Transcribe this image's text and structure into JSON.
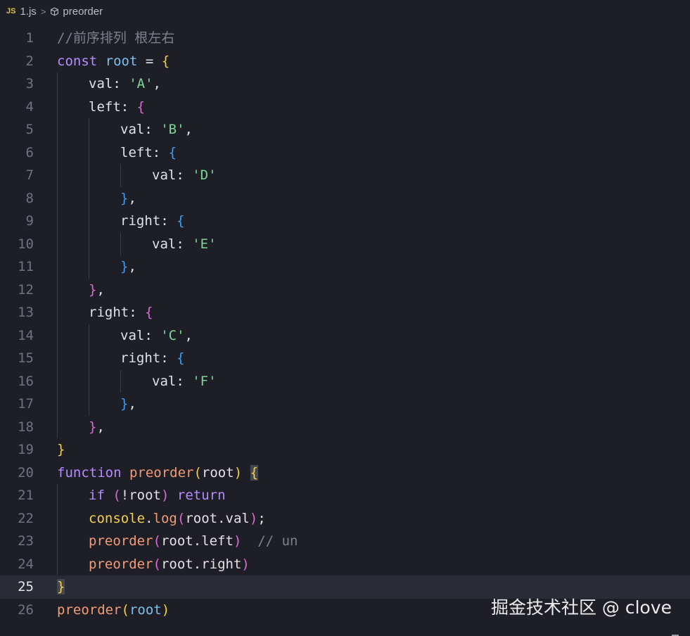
{
  "breadcrumb": {
    "file_icon": "JS",
    "file_name": "1.js",
    "separator": ">",
    "symbol_name": "preorder"
  },
  "editor": {
    "active_line": 25,
    "lines": [
      {
        "n": "1",
        "indent": 0,
        "tokens": [
          {
            "t": "//前序排列 根左右",
            "c": "c"
          }
        ]
      },
      {
        "n": "2",
        "indent": 0,
        "tokens": [
          {
            "t": "const ",
            "c": "k"
          },
          {
            "t": "root",
            "c": "v"
          },
          {
            "t": " = ",
            "c": "p"
          },
          {
            "t": "{",
            "c": "b1"
          }
        ]
      },
      {
        "n": "3",
        "indent": 1,
        "tokens": [
          {
            "t": "val: ",
            "c": "p"
          },
          {
            "t": "'A'",
            "c": "s"
          },
          {
            "t": ",",
            "c": "p"
          }
        ]
      },
      {
        "n": "4",
        "indent": 1,
        "tokens": [
          {
            "t": "left: ",
            "c": "p"
          },
          {
            "t": "{",
            "c": "b2"
          }
        ]
      },
      {
        "n": "5",
        "indent": 2,
        "tokens": [
          {
            "t": "val: ",
            "c": "p"
          },
          {
            "t": "'B'",
            "c": "s"
          },
          {
            "t": ",",
            "c": "p"
          }
        ]
      },
      {
        "n": "6",
        "indent": 2,
        "tokens": [
          {
            "t": "left: ",
            "c": "p"
          },
          {
            "t": "{",
            "c": "b3"
          }
        ]
      },
      {
        "n": "7",
        "indent": 3,
        "tokens": [
          {
            "t": "val: ",
            "c": "p"
          },
          {
            "t": "'D'",
            "c": "s"
          }
        ]
      },
      {
        "n": "8",
        "indent": 2,
        "tokens": [
          {
            "t": "}",
            "c": "b3"
          },
          {
            "t": ",",
            "c": "p"
          }
        ]
      },
      {
        "n": "9",
        "indent": 2,
        "tokens": [
          {
            "t": "right: ",
            "c": "p"
          },
          {
            "t": "{",
            "c": "b3"
          }
        ]
      },
      {
        "n": "10",
        "indent": 3,
        "tokens": [
          {
            "t": "val: ",
            "c": "p"
          },
          {
            "t": "'E'",
            "c": "s"
          }
        ]
      },
      {
        "n": "11",
        "indent": 2,
        "tokens": [
          {
            "t": "}",
            "c": "b3"
          },
          {
            "t": ",",
            "c": "p"
          }
        ]
      },
      {
        "n": "12",
        "indent": 1,
        "tokens": [
          {
            "t": "}",
            "c": "b2"
          },
          {
            "t": ",",
            "c": "p"
          }
        ]
      },
      {
        "n": "13",
        "indent": 1,
        "tokens": [
          {
            "t": "right: ",
            "c": "p"
          },
          {
            "t": "{",
            "c": "b2"
          }
        ]
      },
      {
        "n": "14",
        "indent": 2,
        "tokens": [
          {
            "t": "val: ",
            "c": "p"
          },
          {
            "t": "'C'",
            "c": "s"
          },
          {
            "t": ",",
            "c": "p"
          }
        ]
      },
      {
        "n": "15",
        "indent": 2,
        "tokens": [
          {
            "t": "right: ",
            "c": "p"
          },
          {
            "t": "{",
            "c": "b3"
          }
        ]
      },
      {
        "n": "16",
        "indent": 3,
        "tokens": [
          {
            "t": "val: ",
            "c": "p"
          },
          {
            "t": "'F'",
            "c": "s"
          }
        ]
      },
      {
        "n": "17",
        "indent": 2,
        "tokens": [
          {
            "t": "}",
            "c": "b3"
          },
          {
            "t": ",",
            "c": "p"
          }
        ]
      },
      {
        "n": "18",
        "indent": 1,
        "tokens": [
          {
            "t": "}",
            "c": "b2"
          },
          {
            "t": ",",
            "c": "p"
          }
        ]
      },
      {
        "n": "19",
        "indent": 0,
        "tokens": [
          {
            "t": "}",
            "c": "b1"
          }
        ]
      },
      {
        "n": "20",
        "indent": 0,
        "tokens": [
          {
            "t": "function ",
            "c": "k"
          },
          {
            "t": "preorder",
            "c": "f"
          },
          {
            "t": "(",
            "c": "b1"
          },
          {
            "t": "root",
            "c": "ob"
          },
          {
            "t": ")",
            "c": "b1"
          },
          {
            "t": " ",
            "c": "p"
          },
          {
            "t": "{",
            "c": "b1",
            "hl": true
          }
        ]
      },
      {
        "n": "21",
        "indent": 1,
        "tokens": [
          {
            "t": "if ",
            "c": "k"
          },
          {
            "t": "(",
            "c": "b2"
          },
          {
            "t": "!root",
            "c": "ob"
          },
          {
            "t": ")",
            "c": "b2"
          },
          {
            "t": " return",
            "c": "k"
          }
        ]
      },
      {
        "n": "22",
        "indent": 1,
        "tokens": [
          {
            "t": "console",
            "c": "b1"
          },
          {
            "t": ".",
            "c": "p"
          },
          {
            "t": "log",
            "c": "f"
          },
          {
            "t": "(",
            "c": "b2"
          },
          {
            "t": "root",
            "c": "ob"
          },
          {
            "t": ".",
            "c": "p"
          },
          {
            "t": "val",
            "c": "ob"
          },
          {
            "t": ")",
            "c": "b2"
          },
          {
            "t": ";",
            "c": "p"
          }
        ]
      },
      {
        "n": "23",
        "indent": 1,
        "tokens": [
          {
            "t": "preorder",
            "c": "f"
          },
          {
            "t": "(",
            "c": "b2"
          },
          {
            "t": "root",
            "c": "ob"
          },
          {
            "t": ".",
            "c": "p"
          },
          {
            "t": "left",
            "c": "ob"
          },
          {
            "t": ")",
            "c": "b2"
          },
          {
            "t": "  ",
            "c": "p"
          },
          {
            "t": "// un",
            "c": "c"
          }
        ]
      },
      {
        "n": "24",
        "indent": 1,
        "tokens": [
          {
            "t": "preorder",
            "c": "f"
          },
          {
            "t": "(",
            "c": "b2"
          },
          {
            "t": "root",
            "c": "ob"
          },
          {
            "t": ".",
            "c": "p"
          },
          {
            "t": "right",
            "c": "ob"
          },
          {
            "t": ")",
            "c": "b2"
          }
        ]
      },
      {
        "n": "25",
        "indent": 0,
        "tokens": [
          {
            "t": "}",
            "c": "b1",
            "hl": true
          }
        ]
      },
      {
        "n": "26",
        "indent": 0,
        "tokens": [
          {
            "t": "preorder",
            "c": "f"
          },
          {
            "t": "(",
            "c": "b1"
          },
          {
            "t": "root",
            "c": "v"
          },
          {
            "t": ")",
            "c": "b1"
          }
        ]
      }
    ]
  },
  "watermark": "掘金技术社区 @ clove",
  "colors": {
    "background": "#1e1f26",
    "keyword": "#b48cff",
    "variable": "#7cc0f0",
    "string": "#7ed69a",
    "function": "#f29b78",
    "comment": "#7d818c",
    "bracket_level1": "#f3d049",
    "bracket_level2": "#db6bd2",
    "bracket_level3": "#3f9cf6"
  }
}
